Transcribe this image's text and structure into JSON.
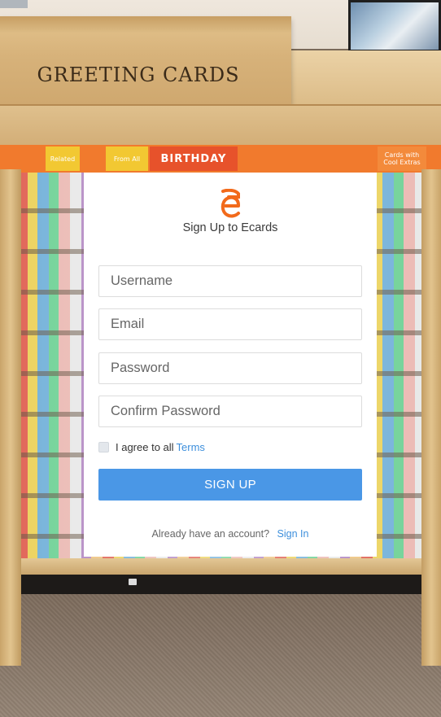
{
  "background": {
    "sign_text": "GREETING CARDS",
    "banner_tiles": [
      "Related",
      "From All",
      "BIRTHDAY",
      "Cards with Cool Extras"
    ]
  },
  "signup": {
    "title": "Sign Up to Ecards",
    "logo_letter": "e",
    "fields": {
      "username_placeholder": "Username",
      "email_placeholder": "Email",
      "password_placeholder": "Password",
      "confirm_password_placeholder": "Confirm Password"
    },
    "agree_label": "I agree to all",
    "terms_link": "Terms",
    "submit_label": "SIGN UP",
    "signin_prompt": "Already have an account?",
    "signin_link": "Sign In"
  },
  "colors": {
    "accent": "#4a97e6",
    "logo": "#f26a1b",
    "link": "#3d8fdc"
  }
}
